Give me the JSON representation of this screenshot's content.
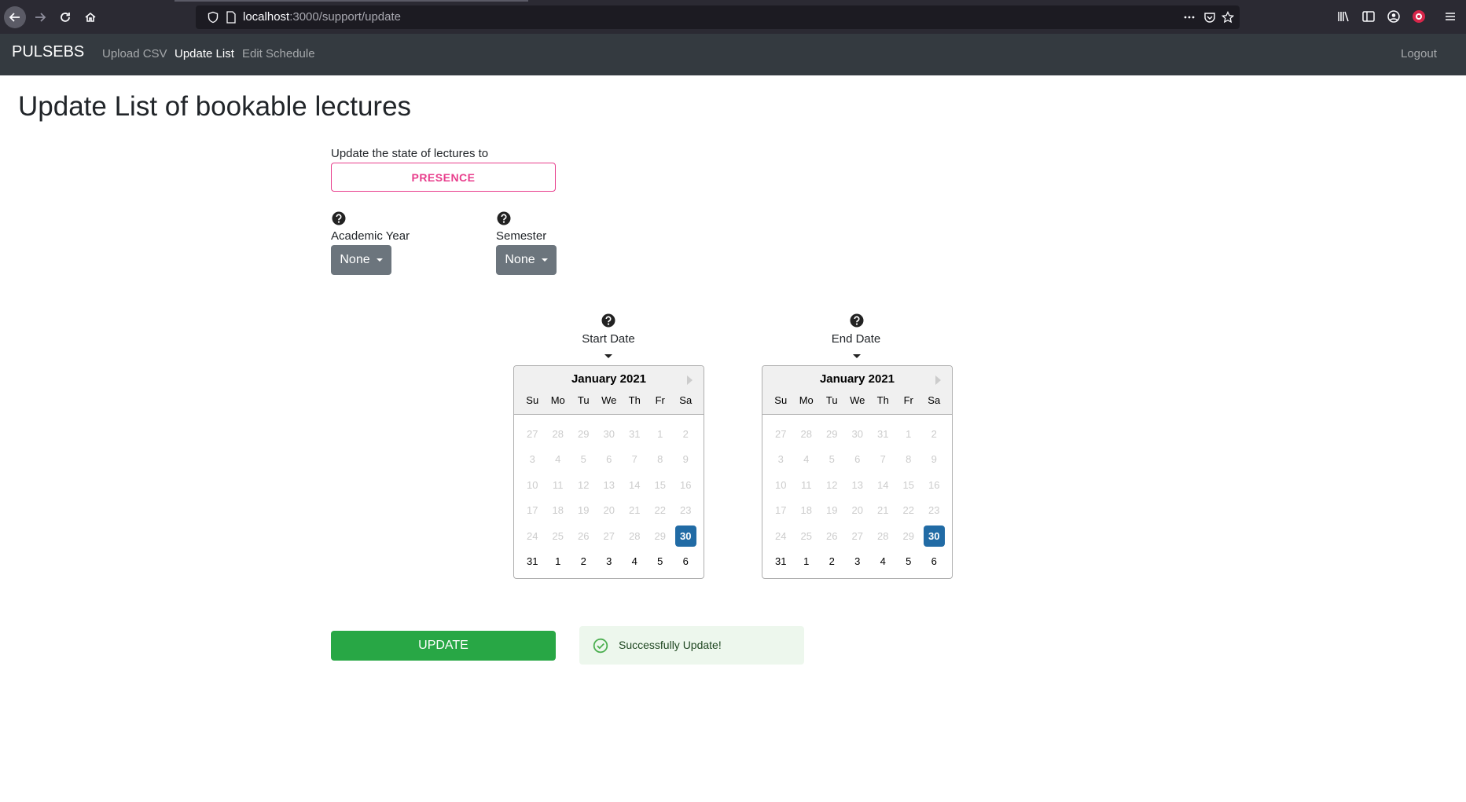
{
  "browser": {
    "url_host": "localhost",
    "url_path": ":3000/support/update"
  },
  "navbar": {
    "brand": "PULSEBS",
    "links": [
      {
        "label": "Upload CSV",
        "active": false
      },
      {
        "label": "Update List",
        "active": true
      },
      {
        "label": "Edit Schedule",
        "active": false
      }
    ],
    "logout": "Logout"
  },
  "page": {
    "title": "Update List of bookable lectures",
    "state_label": "Update the state of lectures to",
    "state_value": "PRESENCE",
    "academic_year_label": "Academic Year",
    "academic_year_value": "None",
    "semester_label": "Semester",
    "semester_value": "None",
    "start_date_label": "Start Date",
    "end_date_label": "End Date",
    "update_button": "UPDATE",
    "alert_text": "Successfully Update!"
  },
  "calendar": {
    "month": "January 2021",
    "weekdays": [
      "Su",
      "Mo",
      "Tu",
      "We",
      "Th",
      "Fr",
      "Sa"
    ],
    "weeks": [
      [
        "27",
        "28",
        "29",
        "30",
        "31",
        "1",
        "2"
      ],
      [
        "3",
        "4",
        "5",
        "6",
        "7",
        "8",
        "9"
      ],
      [
        "10",
        "11",
        "12",
        "13",
        "14",
        "15",
        "16"
      ],
      [
        "17",
        "18",
        "19",
        "20",
        "21",
        "22",
        "23"
      ],
      [
        "24",
        "25",
        "26",
        "27",
        "28",
        "29",
        "30"
      ],
      [
        "31",
        "1",
        "2",
        "3",
        "4",
        "5",
        "6"
      ]
    ],
    "selected_day": "30"
  },
  "colors": {
    "navbar_bg": "#343a40",
    "presence_accent": "#e83e8c",
    "dropdown_bg": "#6c757d",
    "selected_day_bg": "#216ba5",
    "update_bg": "#28a745",
    "alert_bg": "#edf7ed"
  }
}
